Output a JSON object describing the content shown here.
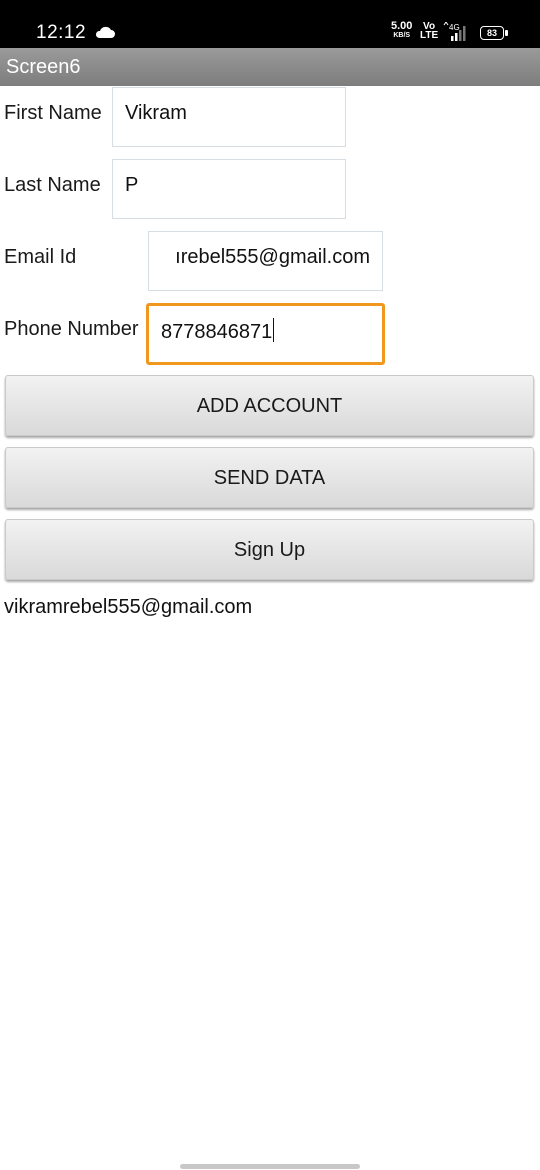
{
  "status_bar": {
    "time": "12:12",
    "speed_value": "5.00",
    "speed_unit": "KB/S",
    "volte_top": "Vo",
    "volte_bottom": "LTE",
    "network": "4G",
    "battery": "83",
    "cloud_icon": "cloud-icon",
    "signal_icon": "signal-icon"
  },
  "title_bar": {
    "title": "Screen6"
  },
  "form": {
    "first_name": {
      "label": "First Name",
      "value": "Vikram"
    },
    "last_name": {
      "label": "Last Name",
      "value": "P"
    },
    "email": {
      "label": "Email Id",
      "value": "ırebel555@gmail.com"
    },
    "phone": {
      "label": "Phone Number",
      "value": "8778846871"
    }
  },
  "buttons": {
    "add_account": "ADD ACCOUNT",
    "send_data": "SEND DATA",
    "sign_up": "Sign Up"
  },
  "result_text": "vikramrebel555@gmail.com",
  "colors": {
    "focus_accent": "#f0971e",
    "title_bar": "#8a8a8a"
  }
}
